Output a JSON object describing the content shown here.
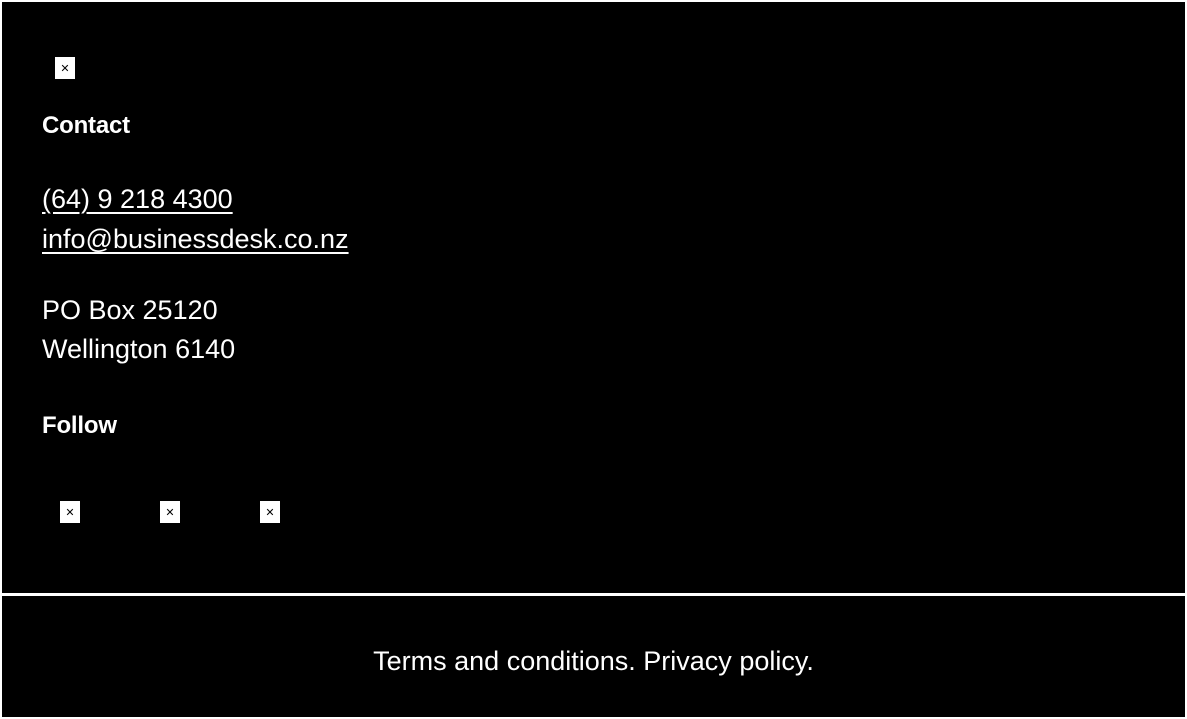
{
  "contact": {
    "logo_icon": "broken-image-icon",
    "heading": "Contact",
    "phone": "(64) 9 218 4300",
    "email": "info@businessdesk.co.nz",
    "address_line1": "PO Box 25120",
    "address_line2": "Wellington 6140"
  },
  "follow": {
    "heading": "Follow",
    "social_icons": [
      "broken-image-icon",
      "broken-image-icon",
      "broken-image-icon"
    ]
  },
  "footer": {
    "terms_label": "Terms and conditions.",
    "privacy_label": "Privacy policy."
  },
  "colors": {
    "background": "#000000",
    "text": "#ffffff",
    "divider": "#ffffff"
  }
}
